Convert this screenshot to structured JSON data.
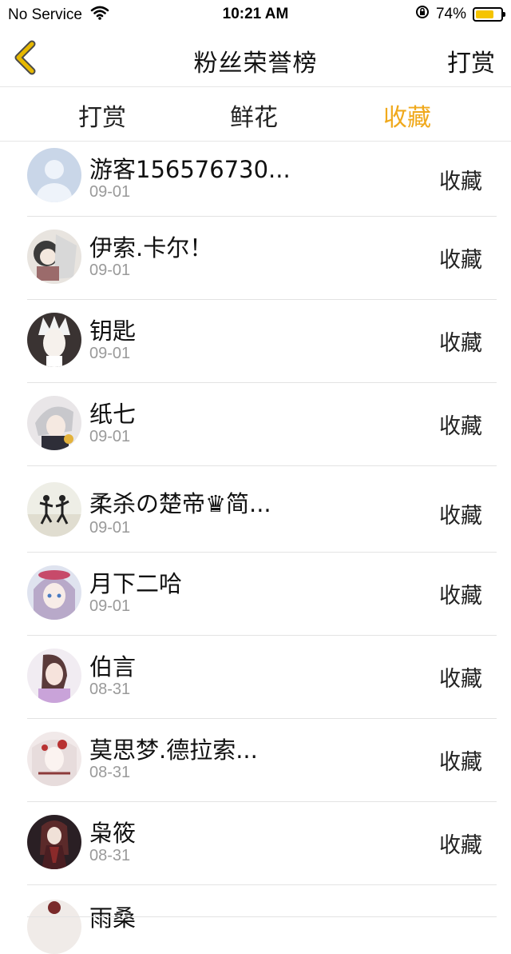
{
  "status_bar": {
    "carrier": "No Service",
    "time": "10:21 AM",
    "battery_percent": "74%",
    "battery_level": 0.74
  },
  "nav": {
    "title": "粉丝荣誉榜",
    "right_label": "打赏"
  },
  "tabs": [
    {
      "label": "打赏",
      "active": false
    },
    {
      "label": "鲜花",
      "active": false
    },
    {
      "label": "收藏",
      "active": true
    }
  ],
  "colors": {
    "accent": "#f0a91c",
    "back_icon_stroke": "#e6b800",
    "back_icon_outline": "#4a4a4a",
    "divider": "#e3e3e3",
    "date_gray": "#9a9a9a"
  },
  "items": [
    {
      "name": "游客156576730...",
      "date": "09-01",
      "action": "收藏"
    },
    {
      "name": "伊索.卡尔！",
      "date": "09-01",
      "action": "收藏"
    },
    {
      "name": "钥匙",
      "date": "09-01",
      "action": "收藏"
    },
    {
      "name": "纸七",
      "date": "09-01",
      "action": "收藏"
    },
    {
      "name": "柔杀の楚帝♛简...",
      "date": "09-01",
      "action": "收藏"
    },
    {
      "name": "月下二哈",
      "date": "09-01",
      "action": "收藏"
    },
    {
      "name": "伯言",
      "date": "08-31",
      "action": "收藏"
    },
    {
      "name": "莫思梦.德拉索...",
      "date": "08-31",
      "action": "收藏"
    },
    {
      "name": "枭筱",
      "date": "08-31",
      "action": "收藏"
    },
    {
      "name": "雨桑",
      "date": "",
      "action": ""
    }
  ]
}
